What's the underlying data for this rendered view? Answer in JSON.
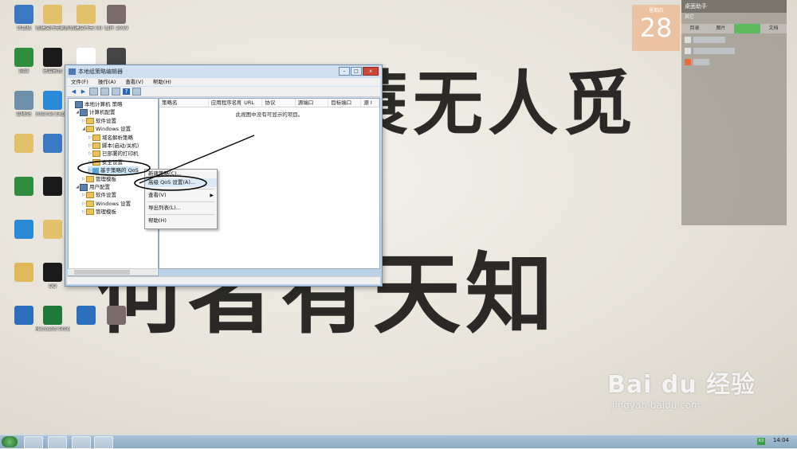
{
  "desktop": {
    "icons": [
      {
        "label": "计算机",
        "color": "#3b78c4"
      },
      {
        "label": "新建文件夹更新",
        "color": "#e3c06a"
      },
      {
        "label": "新建文件夹 (4)",
        "color": "#e3c06a"
      },
      {
        "label": "图片 2019",
        "color": "#7a6a6a"
      },
      {
        "label": "网络",
        "color": "#2f8e3e"
      },
      {
        "label": "迅雷影音",
        "color": "#1a1a1a"
      },
      {
        "label": "",
        "color": "#ffffff"
      },
      {
        "label": "",
        "color": "#444444"
      },
      {
        "label": "回收站",
        "color": "#6d8faa"
      },
      {
        "label": "Internet Explorer",
        "color": "#2a8ad8"
      },
      {
        "label": "",
        "color": "#e3c06a"
      },
      {
        "label": "文档",
        "color": "#e3c06a"
      },
      {
        "label": "",
        "color": "#e3c06a"
      },
      {
        "label": "",
        "color": "#3b78c4"
      },
      {
        "label": "",
        "color": "#e3c06a"
      },
      {
        "label": "",
        "color": "#ffffff"
      },
      {
        "label": "",
        "color": "#2f8e3e"
      },
      {
        "label": "",
        "color": "#1a1a1a"
      },
      {
        "label": "",
        "color": "#2f8e3e"
      },
      {
        "label": "",
        "color": "#2b6fbd"
      },
      {
        "label": "",
        "color": "#2a8ad8"
      },
      {
        "label": "",
        "color": "#e3c06a"
      },
      {
        "label": "",
        "color": "#7a6a6a"
      },
      {
        "label": "",
        "color": "#f3b21a"
      },
      {
        "label": "",
        "color": "#e0b85a"
      },
      {
        "label": "QQ",
        "color": "#1a1a1a"
      },
      {
        "label": "",
        "color": "#e85a2a"
      },
      {
        "label": "",
        "color": "#2b6fbd"
      },
      {
        "label": "",
        "color": "#2b6fbd"
      },
      {
        "label": "Microsoft Office",
        "color": "#1f7a3a"
      },
      {
        "label": "",
        "color": "#2b6fbd"
      },
      {
        "label": "",
        "color": "#7a6a6a"
      }
    ]
  },
  "calendar": {
    "month": "星期四",
    "day": "28"
  },
  "helper": {
    "title": "桌面助手",
    "subtitle": "其它",
    "tabs": [
      "目录",
      "图片",
      "",
      "文档"
    ],
    "active_tab": 2
  },
  "window": {
    "title": "本地组策略编辑器",
    "menu": [
      "文件(F)",
      "操作(A)",
      "查看(V)",
      "帮助(H)"
    ],
    "controls": {
      "minimize": "–",
      "maximize": "□",
      "close": "x"
    },
    "toolbar_icons": [
      "back-arrow",
      "forward-arrow",
      "folder",
      "window",
      "export",
      "help",
      "properties"
    ],
    "tree": [
      {
        "label": "本地计算机 策略",
        "level": 0,
        "kind": "computer"
      },
      {
        "label": "计算机配置",
        "level": 1,
        "kind": "computer",
        "expanded": true
      },
      {
        "label": "软件设置",
        "level": 2,
        "kind": "folder"
      },
      {
        "label": "Windows 设置",
        "level": 2,
        "kind": "folder",
        "expanded": true
      },
      {
        "label": "域名解析策略",
        "level": 3,
        "kind": "folder"
      },
      {
        "label": "脚本(启动/关机)",
        "level": 3,
        "kind": "folder"
      },
      {
        "label": "已部署的打印机",
        "level": 3,
        "kind": "folder"
      },
      {
        "label": "安全设置",
        "level": 3,
        "kind": "folder"
      },
      {
        "label": "基于策略的 QoS",
        "level": 3,
        "kind": "chart",
        "selected": true
      },
      {
        "label": "管理模板",
        "level": 2,
        "kind": "folder"
      },
      {
        "label": "用户配置",
        "level": 1,
        "kind": "computer",
        "expanded": true
      },
      {
        "label": "软件设置",
        "level": 2,
        "kind": "folder"
      },
      {
        "label": "Windows 设置",
        "level": 2,
        "kind": "folder"
      },
      {
        "label": "管理模板",
        "level": 2,
        "kind": "folder"
      }
    ],
    "columns": [
      "策略名",
      "应用程序名称",
      "URL",
      "协议",
      "源端口",
      "目标端口",
      "源 I"
    ],
    "empty_message": "此视图中没有可显示的项目。"
  },
  "context_menu": {
    "items": [
      {
        "label": "新建策略(C)...",
        "submenu": false
      },
      {
        "label": "高级 QoS 设置(A)...",
        "submenu": false,
        "highlighted": true
      },
      {
        "label": "查看(V)",
        "submenu": true
      },
      {
        "label": "导出列表(L)...",
        "submenu": false
      },
      {
        "label": "帮助(H)",
        "submenu": false
      }
    ]
  },
  "wallpaper": {
    "line1": "一蓑无人觅",
    "line2": "何者有天知"
  },
  "taskbar": {
    "clock": "14:04",
    "tray_badge": "63"
  },
  "watermark": {
    "brand": "Bai du 经验",
    "url": "jingyan.baidu.com"
  }
}
